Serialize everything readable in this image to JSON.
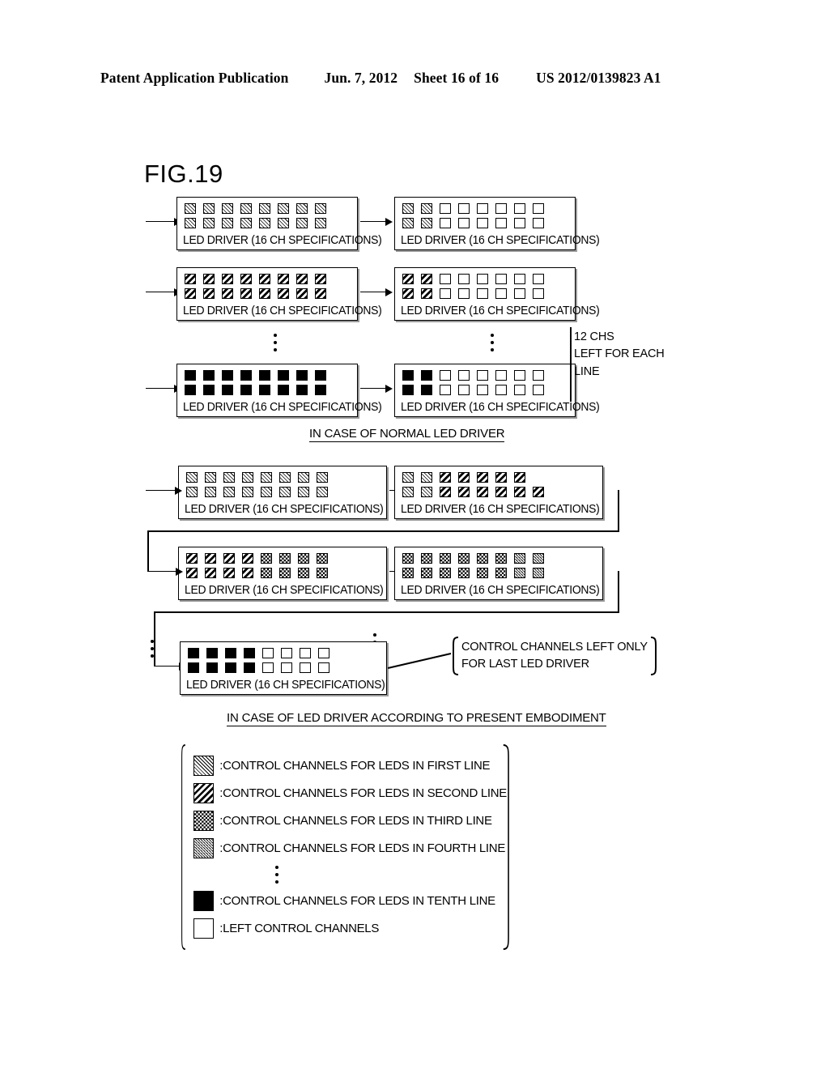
{
  "header": {
    "publication": "Patent Application Publication",
    "date": "Jun. 7, 2012",
    "sheet": "Sheet 16 of 16",
    "number": "US 2012/0139823 A1"
  },
  "figure": {
    "title": "FIG.19",
    "driver_label": "LED DRIVER  (16 CH SPECIFICATIONS)",
    "section_normal_caption": "IN CASE OF NORMAL LED DRIVER",
    "section_embodiment_caption": "IN CASE OF LED DRIVER ACCORDING TO PRESENT EMBODIMENT",
    "callout_chs_left": "12 CHS\nLEFT FOR EACH\nLINE",
    "callout_chs_left_lines": [
      "12 CHS",
      "LEFT FOR EACH",
      "LINE"
    ],
    "callout_last_driver_lines": [
      "CONTROL  CHANNELS  LEFT  ONLY",
      "FOR LAST LED DRIVER"
    ]
  },
  "normal_section": {
    "rows": [
      {
        "line_pattern": "p-l1",
        "left_driver": {
          "top": [
            "p-l1",
            "p-l1",
            "p-l1",
            "p-l1",
            "p-l1",
            "p-l1",
            "p-l1",
            "p-l1"
          ],
          "bottom": [
            "p-l1",
            "p-l1",
            "p-l1",
            "p-l1",
            "p-l1",
            "p-l1",
            "p-l1",
            "p-l1"
          ]
        },
        "right_driver": {
          "top": [
            "p-l1",
            "p-l1",
            "p-empty",
            "p-empty",
            "p-empty",
            "p-empty",
            "p-empty",
            "p-empty"
          ],
          "bottom": [
            "p-l1",
            "p-l1",
            "p-empty",
            "p-empty",
            "p-empty",
            "p-empty",
            "p-empty",
            "p-empty"
          ]
        }
      },
      {
        "line_pattern": "p-l2",
        "left_driver": {
          "top": [
            "p-l2",
            "p-l2",
            "p-l2",
            "p-l2",
            "p-l2",
            "p-l2",
            "p-l2",
            "p-l2"
          ],
          "bottom": [
            "p-l2",
            "p-l2",
            "p-l2",
            "p-l2",
            "p-l2",
            "p-l2",
            "p-l2",
            "p-l2"
          ]
        },
        "right_driver": {
          "top": [
            "p-l2",
            "p-l2",
            "p-empty",
            "p-empty",
            "p-empty",
            "p-empty",
            "p-empty",
            "p-empty"
          ],
          "bottom": [
            "p-l2",
            "p-l2",
            "p-empty",
            "p-empty",
            "p-empty",
            "p-empty",
            "p-empty",
            "p-empty"
          ]
        }
      },
      {
        "line_pattern": "p-l10",
        "left_driver": {
          "top": [
            "p-l10",
            "p-l10",
            "p-l10",
            "p-l10",
            "p-l10",
            "p-l10",
            "p-l10",
            "p-l10"
          ],
          "bottom": [
            "p-l10",
            "p-l10",
            "p-l10",
            "p-l10",
            "p-l10",
            "p-l10",
            "p-l10",
            "p-l10"
          ]
        },
        "right_driver": {
          "top": [
            "p-l10",
            "p-l10",
            "p-empty",
            "p-empty",
            "p-empty",
            "p-empty",
            "p-empty",
            "p-empty"
          ],
          "bottom": [
            "p-l10",
            "p-l10",
            "p-empty",
            "p-empty",
            "p-empty",
            "p-empty",
            "p-empty",
            "p-empty"
          ]
        }
      }
    ]
  },
  "embodiment_section": {
    "rows": [
      {
        "left_driver": {
          "top": [
            "p-l1",
            "p-l1",
            "p-l1",
            "p-l1",
            "p-l1",
            "p-l1",
            "p-l1",
            "p-l1"
          ],
          "bottom": [
            "p-l1",
            "p-l1",
            "p-l1",
            "p-l1",
            "p-l1",
            "p-l1",
            "p-l1",
            "p-l1"
          ]
        },
        "right_driver": {
          "top": [
            "p-l1",
            "p-l1",
            "p-l2",
            "p-l2",
            "p-l2",
            "p-l2",
            "p-l2"
          ],
          "bottom": [
            "p-l1",
            "p-l1",
            "p-l2",
            "p-l2",
            "p-l2",
            "p-l2",
            "p-l2",
            "p-l2"
          ]
        }
      },
      {
        "left_driver": {
          "top": [
            "p-l2",
            "p-l2",
            "p-l2",
            "p-l2",
            "p-l3",
            "p-l3",
            "p-l3",
            "p-l3"
          ],
          "bottom": [
            "p-l2",
            "p-l2",
            "p-l2",
            "p-l2",
            "p-l3",
            "p-l3",
            "p-l3",
            "p-l3"
          ]
        },
        "right_driver": {
          "top": [
            "p-l3",
            "p-l3",
            "p-l3",
            "p-l3",
            "p-l3",
            "p-l3",
            "p-l4",
            "p-l4"
          ],
          "bottom": [
            "p-l3",
            "p-l3",
            "p-l3",
            "p-l3",
            "p-l3",
            "p-l3",
            "p-l4",
            "p-l4"
          ]
        }
      }
    ],
    "last_driver": {
      "top": [
        "p-l10",
        "p-l10",
        "p-l10",
        "p-l10",
        "p-empty",
        "p-empty",
        "p-empty",
        "p-empty"
      ],
      "bottom": [
        "p-l10",
        "p-l10",
        "p-l10",
        "p-l10",
        "p-empty",
        "p-empty",
        "p-empty",
        "p-empty"
      ]
    }
  },
  "legend": {
    "items": [
      {
        "pattern": "p-l1",
        "text": ":CONTROL CHANNELS FOR LEDS IN FIRST LINE"
      },
      {
        "pattern": "p-l2",
        "text": ":CONTROL CHANNELS FOR LEDS IN SECOND LINE"
      },
      {
        "pattern": "p-l3",
        "text": ":CONTROL CHANNELS FOR LEDS IN THIRD LINE"
      },
      {
        "pattern": "p-l4",
        "text": ":CONTROL CHANNELS FOR LEDS IN FOURTH LINE"
      },
      {
        "pattern": "p-l10",
        "text": ":CONTROL CHANNELS FOR LEDS IN TENTH LINE"
      },
      {
        "pattern": "p-empty",
        "text": ":LEFT CONTROL CHANNELS"
      }
    ],
    "ellipsis_after_index": 3
  }
}
